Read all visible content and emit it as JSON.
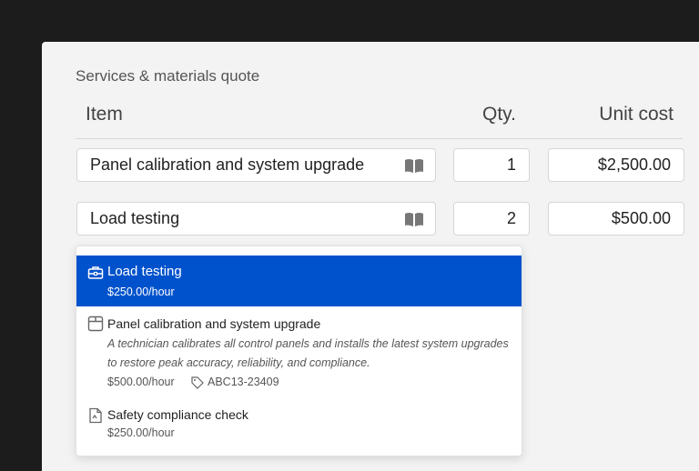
{
  "title": "Services & materials quote",
  "columns": {
    "item": "Item",
    "qty": "Qty.",
    "unit_cost": "Unit cost"
  },
  "rows": [
    {
      "item": "Panel calibration and system upgrade",
      "qty": "1",
      "unit_cost": "$2,500.00"
    },
    {
      "item": "Load testing",
      "qty": "2",
      "unit_cost": "$500.00"
    }
  ],
  "dropdown": {
    "options": [
      {
        "name": "Load testing",
        "price": "$250.00/hour",
        "icon": "toolbox-icon",
        "selected": true
      },
      {
        "name": "Panel calibration and system upgrade",
        "description": "A technician calibrates all control panels and installs the latest system upgrades to restore peak accuracy, reliability, and compliance.",
        "price": "$500.00/hour",
        "code": "ABC13-23409",
        "icon": "box-icon"
      },
      {
        "name": "Safety compliance check",
        "price": "$250.00/hour",
        "icon": "document-icon"
      }
    ]
  },
  "colors": {
    "accent": "#0052cc",
    "background": "#f3f3f3",
    "frame": "#1c1c1c"
  }
}
